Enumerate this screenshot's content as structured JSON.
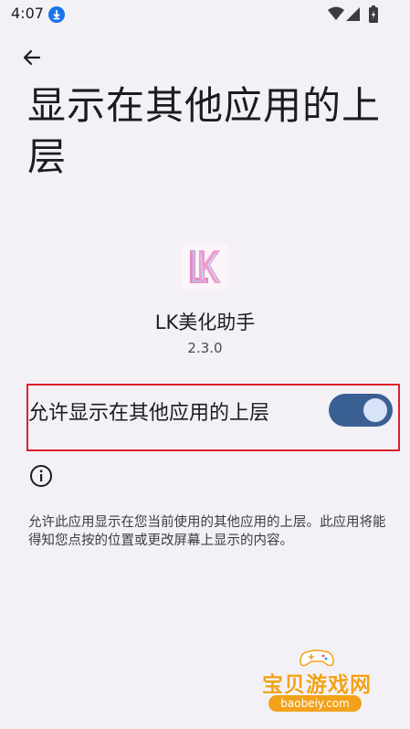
{
  "status_bar": {
    "time": "4:07"
  },
  "title": "显示在其他应用的上层",
  "app": {
    "name": "LK美化助手",
    "version": "2.3.0",
    "icon_label": "LK"
  },
  "toggle": {
    "label": "允许显示在其他应用的上层",
    "state": "on"
  },
  "description": "允许此应用显示在您当前使用的其他应用的上层。此应用将能得知您点按的位置或更改屏幕上显示的内容。",
  "watermark": {
    "title": "宝贝游戏网",
    "url": "baobeiy.com"
  },
  "colors": {
    "background": "#f3f1f6",
    "toggle_track": "#3a5f92",
    "toggle_thumb": "#d7e3f8",
    "highlight": "#e11d2c",
    "watermark": "#f2a21a"
  }
}
